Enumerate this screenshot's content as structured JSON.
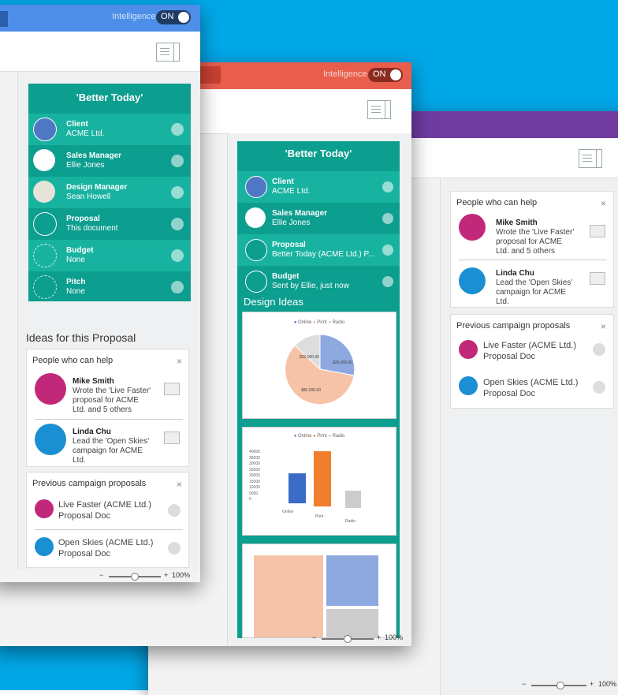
{
  "colors": {
    "bg": "#00a8e8",
    "blue_bar": "#4d8fe8",
    "red_bar": "#e85d4c",
    "purple_bar": "#6f3ba0",
    "teal": "#0c9e8e"
  },
  "intelligence": {
    "label": "Intelligence",
    "on_text": "ON"
  },
  "team": {
    "title": "'Better Today'",
    "rows": [
      {
        "role": "Client",
        "value": "ACME Ltd.",
        "icon": "building-icon"
      },
      {
        "role": "Sales Manager",
        "value": "Ellie Jones",
        "icon": "person-icon"
      },
      {
        "role": "Design Manager",
        "value": "Sean Howell",
        "icon": "person-icon"
      },
      {
        "role": "Proposal",
        "value": "This document",
        "icon": "document-icon"
      },
      {
        "role": "Budget",
        "value": "None",
        "icon": "empty-circle"
      },
      {
        "role": "Pitch",
        "value": "None",
        "icon": "empty-circle"
      }
    ]
  },
  "team_mid": {
    "title": "'Better Today'",
    "rows": [
      {
        "role": "Client",
        "value": "ACME Ltd."
      },
      {
        "role": "Sales Manager",
        "value": "Ellie Jones"
      },
      {
        "role": "Proposal",
        "value": "Better Today (ACME Ltd.) P..."
      },
      {
        "role": "Budget",
        "value": "Sent by Ellie, just now"
      }
    ],
    "design_ideas": "Design Ideas"
  },
  "ideas_heading": "Ideas for this Proposal",
  "people": {
    "title": "People who can help",
    "close": "×",
    "items": [
      {
        "name": "Mike Smith",
        "desc": [
          "Wrote the 'Live Faster'",
          "proposal for ACME",
          "Ltd. and 5 others"
        ]
      },
      {
        "name": "Linda Chu",
        "desc": [
          "Lead the 'Open Skies'",
          "campaign for ACME",
          "Ltd."
        ]
      }
    ]
  },
  "previous": {
    "title": "Previous campaign proposals",
    "close": "×",
    "items": [
      {
        "name": "Live Faster (ACME Ltd.)",
        "type": "Proposal Doc"
      },
      {
        "name": "Open Skies (ACME Ltd.)",
        "type": "Proposal Doc"
      }
    ]
  },
  "zoom": {
    "minus": "−",
    "plus": "+",
    "level": "100%"
  },
  "pie_legend": [
    "Online",
    "Print",
    "Radio"
  ],
  "pie_labels": [
    "$20,000.00",
    "$25,000.00",
    "$80,000.00"
  ],
  "bar_legend": [
    "Online",
    "Print",
    "Radio"
  ],
  "bar_yticks": [
    "40000",
    "35000",
    "30000",
    "25000",
    "20000",
    "15000",
    "10000",
    "5000",
    "0"
  ],
  "bar_xticks": [
    "Online",
    "Print",
    "Radio"
  ]
}
